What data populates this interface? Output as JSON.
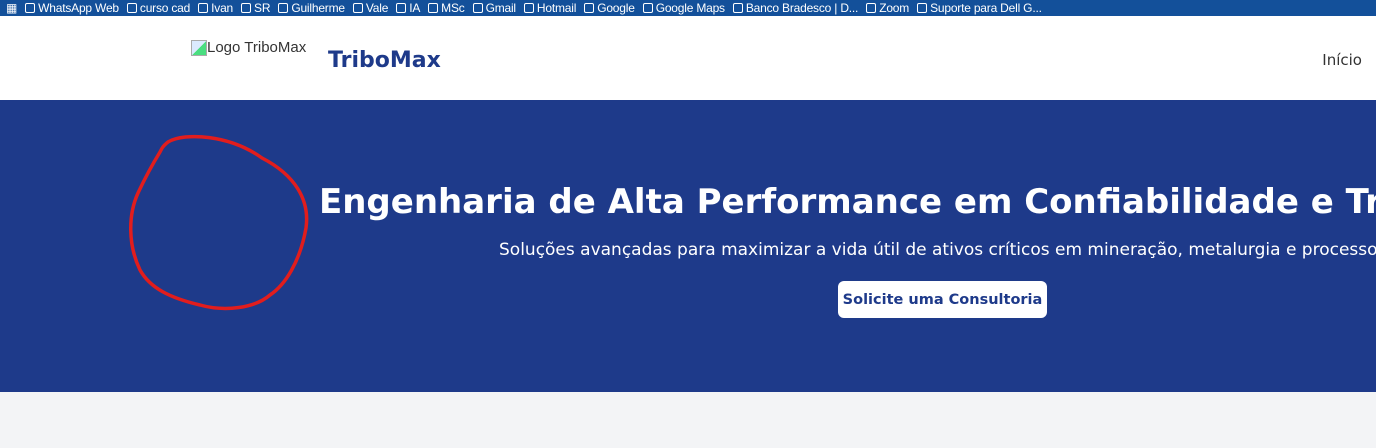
{
  "bookmarks": [
    "WhatsApp Web",
    "curso cad",
    "Ivan",
    "SR",
    "Guilherme",
    "Vale",
    "IA",
    "MSc",
    "Gmail",
    "Hotmail",
    "Google",
    "Google Maps",
    "Banco Bradesco | D...",
    "Zoom",
    "Suporte para Dell G..."
  ],
  "header": {
    "logo_alt": "Logo TriboMax",
    "brand": "TriboMax",
    "nav": [
      "Início"
    ]
  },
  "hero": {
    "title": "Engenharia de Alta Performance em Confiabilidade e Tribologia",
    "subtitle": "Soluções avançadas para maximizar a vida útil de ativos críticos em mineração, metalurgia e processos pesados.",
    "cta": "Solicite uma Consultoria"
  },
  "colors": {
    "primary": "#1e3a8a",
    "annotation": "#e11d1d"
  }
}
